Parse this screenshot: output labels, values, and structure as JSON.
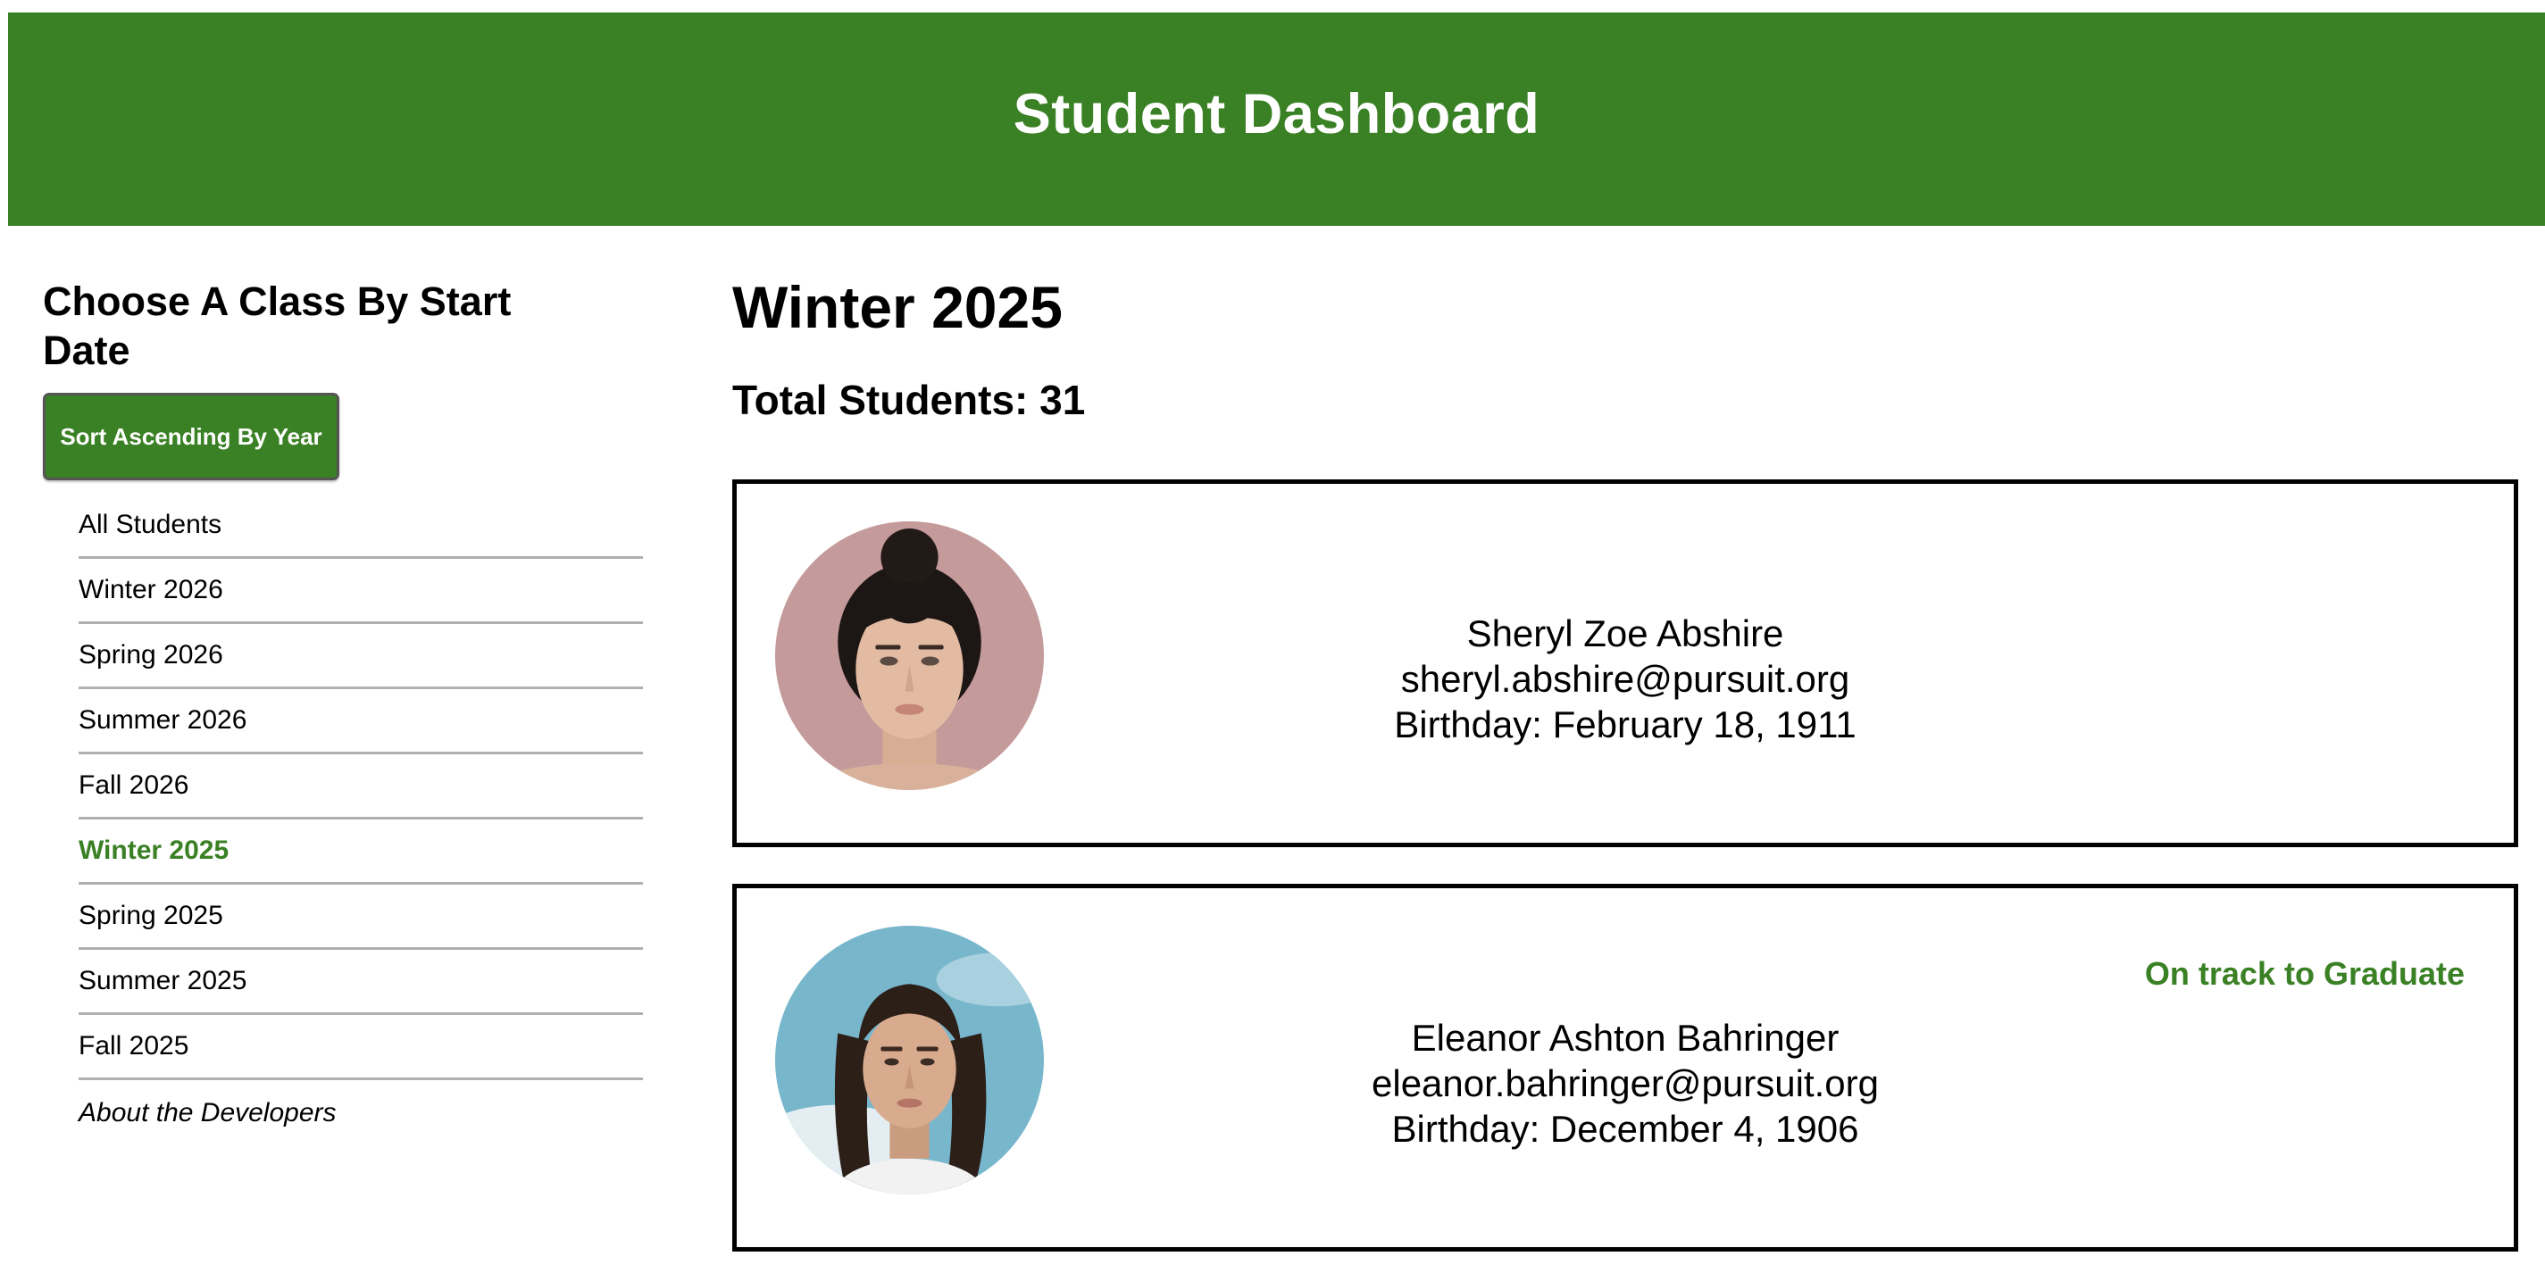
{
  "header": {
    "title": "Student Dashboard"
  },
  "sidebar": {
    "heading": "Choose A Class By Start Date",
    "sort_button": "Sort Ascending By Year",
    "items": [
      {
        "label": "All Students"
      },
      {
        "label": "Winter 2026"
      },
      {
        "label": "Spring 2026"
      },
      {
        "label": "Summer 2026"
      },
      {
        "label": "Fall 2026"
      },
      {
        "label": "Winter 2025",
        "active": true
      },
      {
        "label": "Spring 2025"
      },
      {
        "label": "Summer 2025"
      },
      {
        "label": "Fall 2025"
      },
      {
        "label": "About the Developers"
      }
    ]
  },
  "main": {
    "class_title": "Winter 2025",
    "total_students": "Total Students: 31",
    "students": [
      {
        "name": "Sheryl Zoe Abshire",
        "email": "sheryl.abshire@pursuit.org",
        "birthday": "Birthday: February 18, 1911",
        "status": ""
      },
      {
        "name": "Eleanor Ashton Bahringer",
        "email": "eleanor.bahringer@pursuit.org",
        "birthday": "Birthday: December 4, 1906",
        "status": "On track to Graduate"
      }
    ]
  },
  "colors": {
    "accent": "#3a8024",
    "card_border": "#000000",
    "divider": "#b0b0b0"
  }
}
